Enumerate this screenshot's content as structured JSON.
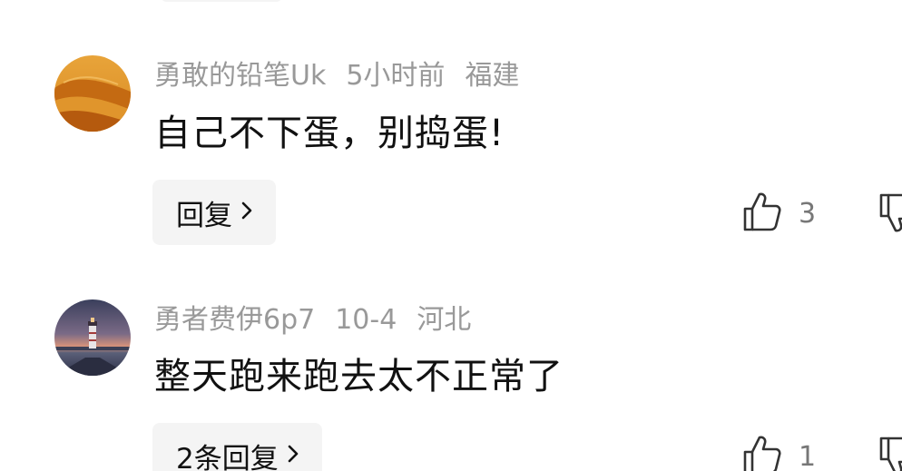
{
  "comments": [
    {
      "username": "勇敢的铅笔Uk",
      "time": "5小时前",
      "location": "福建",
      "content": "自己不下蛋，别捣蛋!",
      "reply_label": "回复",
      "like_count": "3",
      "avatar_icon": "desert-dune-avatar",
      "like_icon": "thumbs-up-icon",
      "dislike_icon": "thumbs-down-icon"
    },
    {
      "username": "勇者费伊6p7",
      "time": "10-4",
      "location": "河北",
      "content": "整天跑来跑去太不正常了",
      "reply_label": "2条回复",
      "like_count": "1",
      "avatar_icon": "lighthouse-sunset-avatar",
      "like_icon": "thumbs-up-icon",
      "dislike_icon": "thumbs-down-icon"
    }
  ],
  "colors": {
    "meta_text": "#999999",
    "body_text": "#111111",
    "button_bg": "#f4f4f4",
    "count_text": "#777777"
  }
}
